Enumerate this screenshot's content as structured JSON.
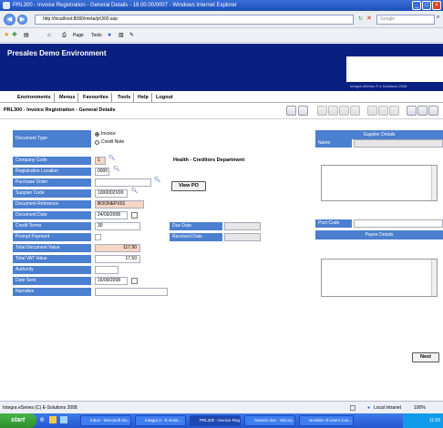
{
  "window": {
    "title": "PRL300 - Invoice Registration - General Details - 18.00.00/0007 - Windows Internet Explorer"
  },
  "browser": {
    "address": "http://localhost:8080/meta/prl300.asp",
    "search_placeholder": "Google",
    "toolbar": {
      "page": "Page",
      "tools": "Tools"
    }
  },
  "banner": {
    "title": "Presales Demo Environment",
    "copyright": "Integra eSeries © e-Solutions 2008"
  },
  "menu": [
    "Environments",
    "Menus",
    "Favourites",
    "Tools",
    "Help",
    "Logout"
  ],
  "page": {
    "title": "PRL300 - Invoice Registration - General Details"
  },
  "form": {
    "document_type": {
      "label": "Document Type",
      "options": [
        "Invoice",
        "Credit Note"
      ],
      "selected": "Invoice"
    },
    "company_code": {
      "label": "Company Code",
      "value": "1",
      "description": "Health - Creditors Department"
    },
    "registration_location": {
      "label": "Registration Location",
      "value": "0000"
    },
    "purchase_order": {
      "label": "Purchase Order",
      "value": ""
    },
    "view_po_button": "View PO",
    "supplier_code": {
      "label": "Supplier Code",
      "value": "1000002X00"
    },
    "document_reference": {
      "label": "Document Reference",
      "value": "BOONEPX01"
    },
    "document_date": {
      "label": "Document Date",
      "value": "24/09/2008"
    },
    "credit_terms": {
      "label": "Credit Terms",
      "value": "30"
    },
    "due_date": {
      "label": "Due Date",
      "value": ""
    },
    "prompt_payment": {
      "label": "Prompt Payment"
    },
    "received_date": {
      "label": "Received Date",
      "value": ""
    },
    "total_document_value": {
      "label": "Total Document Value",
      "value": "117.50"
    },
    "total_vat_value": {
      "label": "Total VAT Value",
      "value": "17.50"
    },
    "authority": {
      "label": "Authority",
      "value": ""
    },
    "date_sent": {
      "label": "Date Sent",
      "value": "16/09/2008"
    },
    "narrative": {
      "label": "Narrative",
      "value": ""
    }
  },
  "supplier_panel": {
    "title": "Supplier Details",
    "name_label": "Name",
    "post_code_label": "Post Code"
  },
  "payee_panel": {
    "title": "Payee Details"
  },
  "next_button": "Next",
  "status": {
    "left": "Integra eSeries (C) E-Solutions 2008",
    "zone": "Local intranet",
    "zoom": "100%"
  },
  "taskbar": {
    "start": "start",
    "items": [
      "Inbox - Microsoft Ou...",
      "Integra 2 - E-Solut...",
      "PRL300 - Invoice Reg...",
      "Generic doc - Micros...",
      "Number of Users Con..."
    ],
    "clock": "11:09"
  }
}
